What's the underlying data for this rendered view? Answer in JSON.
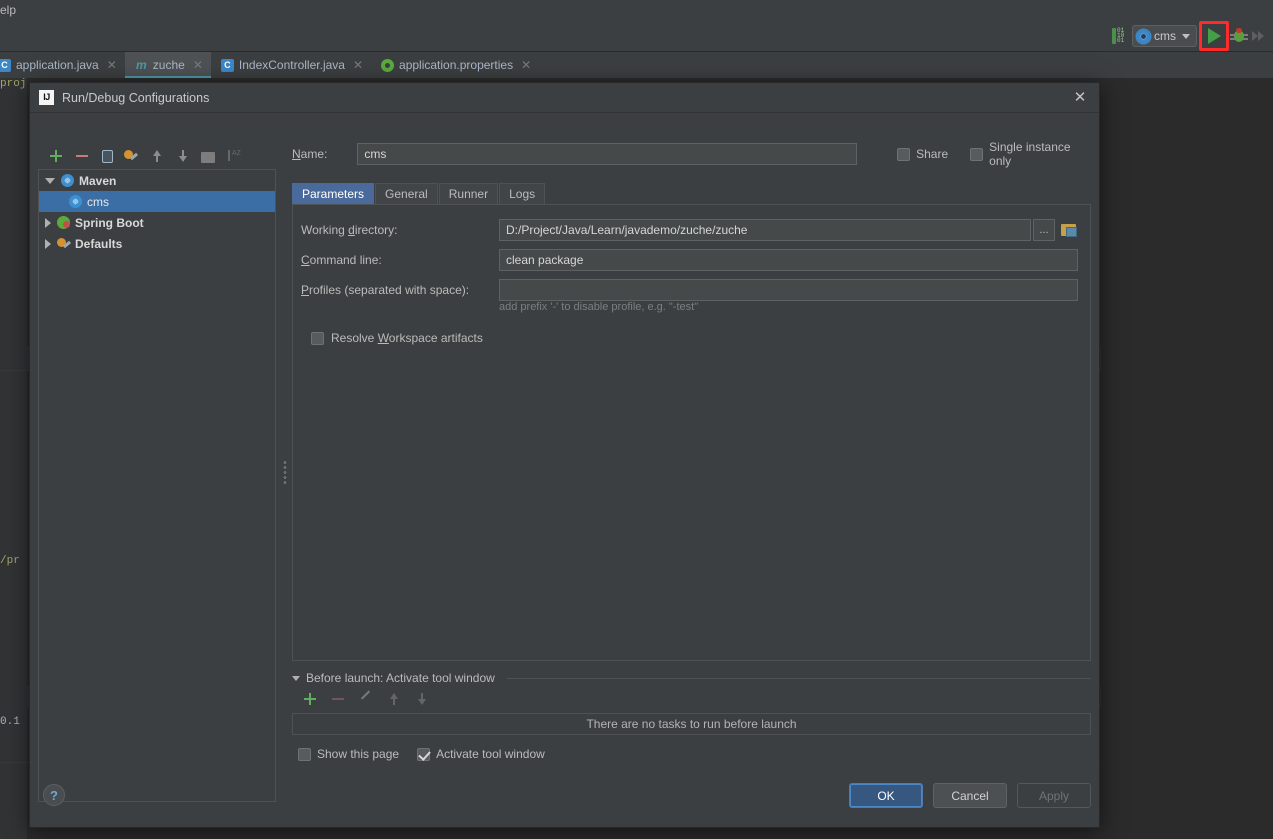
{
  "ide": {
    "menubar": {
      "visible_item": "elp"
    },
    "toolbar": {
      "binary_icon": "binary-file-icon",
      "run_config_name": "cms",
      "run_button": "run-icon",
      "debug_button": "debug-icon",
      "disabled_button": "run-with-coverage-icon"
    },
    "editor_tabs": [
      {
        "label": "application.java",
        "icon": "java-class-icon",
        "active": false
      },
      {
        "label": "zuche",
        "icon": "maven-icon",
        "active": true
      },
      {
        "label": "IndexController.java",
        "icon": "java-class-icon",
        "active": false
      },
      {
        "label": "application.properties",
        "icon": "spring-properties-icon",
        "active": false
      }
    ],
    "editor_background_fragments": [
      "proj",
      "/pr",
      "0.1"
    ]
  },
  "dialog": {
    "title": "Run/Debug Configurations",
    "close_label": "✕",
    "tree_toolbar": [
      {
        "name": "add-configuration",
        "icon": "plus-icon"
      },
      {
        "name": "remove-configuration",
        "icon": "minus-icon"
      },
      {
        "name": "copy-configuration",
        "icon": "copy-icon"
      },
      {
        "name": "edit-templates",
        "icon": "wrench-icon"
      },
      {
        "name": "move-up",
        "icon": "arrow-up-icon"
      },
      {
        "name": "move-down",
        "icon": "arrow-down-icon"
      },
      {
        "name": "create-folder",
        "icon": "folder-icon"
      },
      {
        "name": "sort-configurations",
        "icon": "sort-icon"
      }
    ],
    "tree": [
      {
        "label": "Maven",
        "icon": "maven-icon",
        "expanded": true,
        "selected": false,
        "level": 0
      },
      {
        "label": "cms",
        "icon": "maven-icon",
        "expanded": null,
        "selected": true,
        "level": 1
      },
      {
        "label": "Spring Boot",
        "icon": "spring-boot-icon",
        "expanded": false,
        "selected": false,
        "level": 0
      },
      {
        "label": "Defaults",
        "icon": "defaults-icon",
        "expanded": false,
        "selected": false,
        "level": 0
      }
    ],
    "name_label": "Name:",
    "name_value": "cms",
    "share": {
      "label": "Share",
      "checked": false
    },
    "single_instance": {
      "label": "Single instance only",
      "checked": false
    },
    "tabs": [
      {
        "label": "Parameters",
        "active": true
      },
      {
        "label": "General",
        "active": false
      },
      {
        "label": "Runner",
        "active": false
      },
      {
        "label": "Logs",
        "active": false
      }
    ],
    "parameters": {
      "working_directory_label": "Working directory:",
      "working_directory_value": "D:/Project/Java/Learn/javademo/zuche/zuche",
      "browse_label": "...",
      "folder_icon": "insert-macro-icon",
      "command_line_label": "Command line:",
      "command_line_value": "clean package",
      "profiles_label": "Profiles (separated with space):",
      "profiles_value": "",
      "profiles_hint": "add prefix '-' to disable profile, e.g. \"-test\"",
      "resolve_workspace": {
        "label": "Resolve Workspace artifacts",
        "checked": false
      }
    },
    "before_launch": {
      "header": "Before launch: Activate tool window",
      "toolbar": [
        {
          "name": "add-task",
          "icon": "plus-icon"
        },
        {
          "name": "remove-task",
          "icon": "minus-icon"
        },
        {
          "name": "edit-task",
          "icon": "pencil-icon"
        },
        {
          "name": "move-task-up",
          "icon": "arrow-up-icon"
        },
        {
          "name": "move-task-down",
          "icon": "arrow-down-icon"
        }
      ],
      "empty_message": "There are no tasks to run before launch",
      "show_this_page": {
        "label": "Show this page",
        "checked": false
      },
      "activate_tool_window": {
        "label": "Activate tool window",
        "checked": true
      }
    },
    "footer": {
      "help_label": "?",
      "ok_label": "OK",
      "cancel_label": "Cancel",
      "apply_label": "Apply"
    }
  },
  "colors": {
    "dialog_bg": "#3c3f41",
    "editor_bg": "#2b2b2b",
    "selection_blue": "#3a6ea5",
    "tab_active_blue": "#4a6a9b",
    "primary_button": "#365880",
    "run_green": "#43a047",
    "highlight_red": "#ff2a2a"
  }
}
